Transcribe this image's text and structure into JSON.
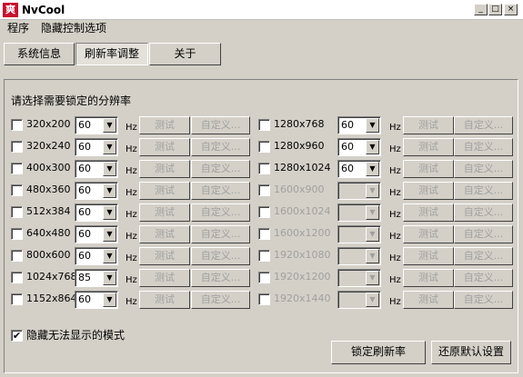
{
  "window": {
    "title": "NvCool",
    "app_icon_glyph": "爽"
  },
  "menu": [
    "程序",
    "隐藏控制选项"
  ],
  "tabs": [
    "系统信息",
    "刷新率调整",
    "关于"
  ],
  "section_title": "请选择需要锁定的分辨率",
  "hz_label": "Hz",
  "test_label": "测试",
  "custom_label": "自定义...",
  "left_rows": [
    {
      "res": "320x200",
      "rate": "60",
      "enabled": true
    },
    {
      "res": "320x240",
      "rate": "60",
      "enabled": true
    },
    {
      "res": "400x300",
      "rate": "60",
      "enabled": true
    },
    {
      "res": "480x360",
      "rate": "60",
      "enabled": true
    },
    {
      "res": "512x384",
      "rate": "60",
      "enabled": true
    },
    {
      "res": "640x480",
      "rate": "60",
      "enabled": true
    },
    {
      "res": "800x600",
      "rate": "60",
      "enabled": true
    },
    {
      "res": "1024x768",
      "rate": "85",
      "enabled": true
    },
    {
      "res": "1152x864",
      "rate": "60",
      "enabled": true
    }
  ],
  "right_rows": [
    {
      "res": "1280x768",
      "rate": "60",
      "enabled": true
    },
    {
      "res": "1280x960",
      "rate": "60",
      "enabled": true
    },
    {
      "res": "1280x1024",
      "rate": "60",
      "enabled": true
    },
    {
      "res": "1600x900",
      "rate": "",
      "enabled": false
    },
    {
      "res": "1600x1024",
      "rate": "",
      "enabled": false
    },
    {
      "res": "1600x1200",
      "rate": "",
      "enabled": false
    },
    {
      "res": "1920x1080",
      "rate": "",
      "enabled": false
    },
    {
      "res": "1920x1200",
      "rate": "",
      "enabled": false
    },
    {
      "res": "1920x1440",
      "rate": "",
      "enabled": false
    }
  ],
  "hide_modes": {
    "label": "隐藏无法显示的模式",
    "checked": true,
    "check_glyph": "✔"
  },
  "buttons": {
    "lock": "锁定刷新率",
    "restore": "还原默认设置"
  },
  "window_buttons": {
    "minimize": "_",
    "maximize": "□",
    "close": "×"
  },
  "combo_arrow": "▼"
}
